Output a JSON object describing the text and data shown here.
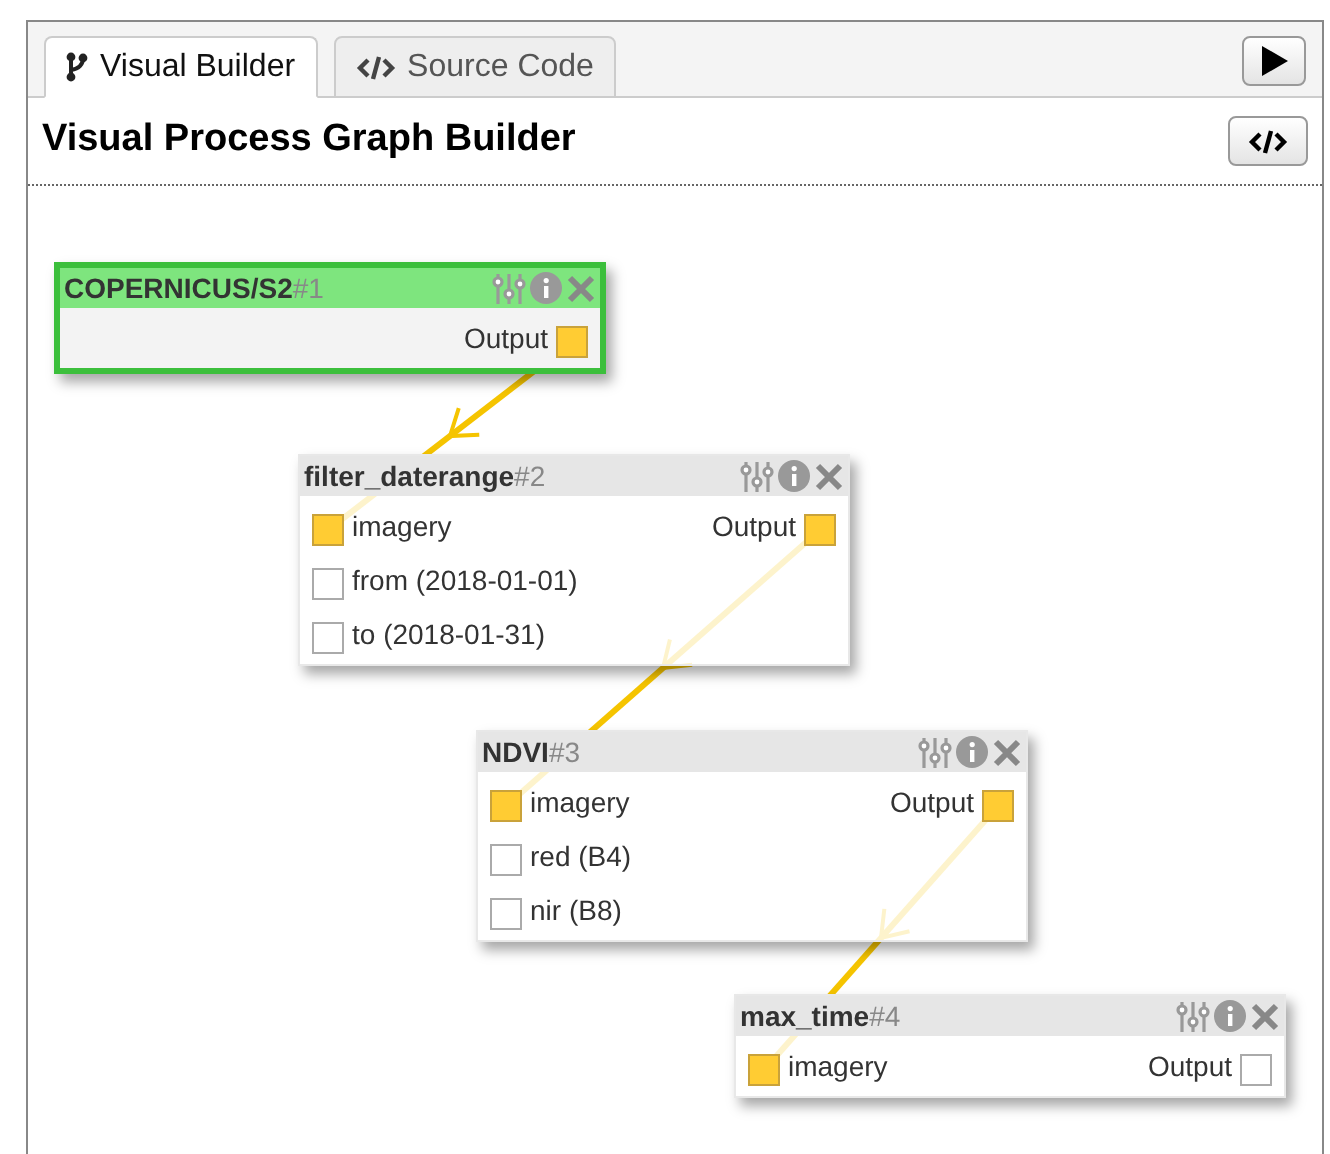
{
  "tabs": [
    {
      "label": "Visual Builder",
      "selected": true
    },
    {
      "label": "Source Code",
      "selected": false
    }
  ],
  "title": "Visual Process Graph Builder",
  "nodes": [
    {
      "name": "COPERNICUS/S2",
      "number": "#1",
      "selected": true,
      "output": {
        "label": "Output",
        "connected": true
      }
    },
    {
      "name": "filter_daterange",
      "number": "#2",
      "selected": false,
      "inputs": [
        {
          "label": "imagery",
          "connected": true
        },
        {
          "label": "from (2018-01-01)",
          "connected": false
        },
        {
          "label": "to (2018-01-31)",
          "connected": false
        }
      ],
      "output": {
        "label": "Output",
        "connected": true
      }
    },
    {
      "name": "NDVI",
      "number": "#3",
      "selected": false,
      "inputs": [
        {
          "label": "imagery",
          "connected": true
        },
        {
          "label": "red (B4)",
          "connected": false
        },
        {
          "label": "nir (B8)",
          "connected": false
        }
      ],
      "output": {
        "label": "Output",
        "connected": true
      }
    },
    {
      "name": "max_time",
      "number": "#4",
      "selected": false,
      "inputs": [
        {
          "label": "imagery",
          "connected": true
        }
      ],
      "output": {
        "label": "Output",
        "connected": false
      }
    }
  ]
}
